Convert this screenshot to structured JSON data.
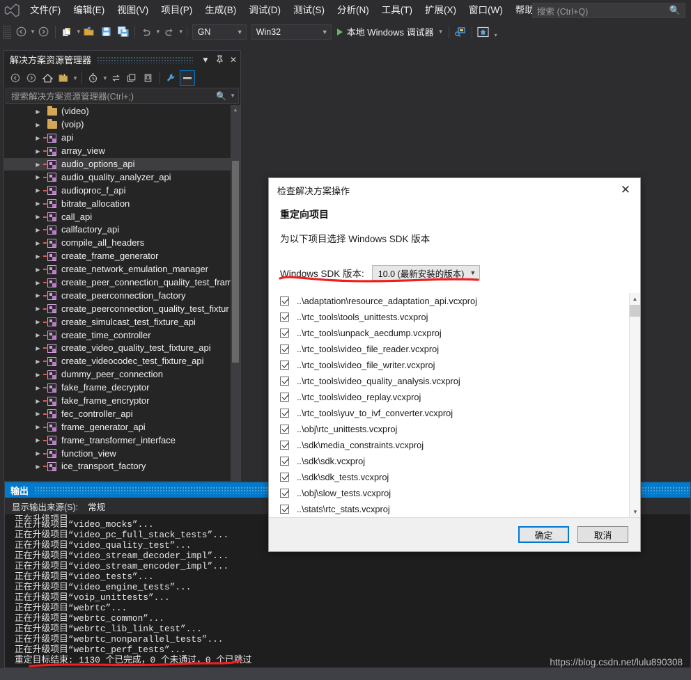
{
  "menubar": {
    "logo": "vs-logo",
    "items": [
      "文件(F)",
      "编辑(E)",
      "视图(V)",
      "项目(P)",
      "生成(B)",
      "调试(D)",
      "测试(S)",
      "分析(N)",
      "工具(T)",
      "扩展(X)",
      "窗口(W)",
      "帮助(H)"
    ],
    "search": {
      "placeholder": "搜索 (Ctrl+Q)",
      "icon": "search-icon"
    }
  },
  "toolbar": {
    "nav_back_icon": "arrow-back-icon",
    "nav_forward_icon": "arrow-forward-icon",
    "new_item_icon": "new-item-icon",
    "open_file_icon": "open-folder-icon",
    "save_icon": "save-icon",
    "save_all_icon": "save-all-icon",
    "undo_icon": "undo-icon",
    "redo_icon": "redo-icon",
    "config_combo": {
      "value": "GN",
      "caret": "chevron-down-icon"
    },
    "platform_combo": {
      "value": "Win32",
      "caret": "chevron-down-icon"
    },
    "run_label": "本地 Windows 调试器",
    "run_icon": "play-icon",
    "run_caret": "chevron-down-icon",
    "attach_icon": "attach-process-icon",
    "home_icon": "home-icon",
    "overflow_icon": "toolbar-overflow-icon"
  },
  "solution_explorer": {
    "title": "解决方案资源管理器",
    "title_dropdown_icon": "chevron-down-icon",
    "pin_icon": "pin-icon",
    "close_icon": "close-icon",
    "toolbar_icons": [
      "back-icon",
      "forward-icon",
      "home-icon",
      "show-all-files-icon",
      "pending-changes-icon",
      "sync-icon",
      "collapse-all-icon",
      "properties-icon",
      "wrench-icon",
      "preview-icon"
    ],
    "search": {
      "placeholder": "搜索解决方案资源管理器(Ctrl+;)",
      "icon": "search-icon",
      "caret": "chevron-down-icon"
    },
    "selected_index": 4,
    "items": [
      {
        "label": "(video)",
        "type": "folder"
      },
      {
        "label": "(voip)",
        "type": "folder"
      },
      {
        "label": "api",
        "type": "project"
      },
      {
        "label": "array_view",
        "type": "project"
      },
      {
        "label": "audio_options_api",
        "type": "project"
      },
      {
        "label": "audio_quality_analyzer_api",
        "type": "project"
      },
      {
        "label": "audioproc_f_api",
        "type": "project"
      },
      {
        "label": "bitrate_allocation",
        "type": "project"
      },
      {
        "label": "call_api",
        "type": "project"
      },
      {
        "label": "callfactory_api",
        "type": "project"
      },
      {
        "label": "compile_all_headers",
        "type": "project"
      },
      {
        "label": "create_frame_generator",
        "type": "project"
      },
      {
        "label": "create_network_emulation_manager",
        "type": "project"
      },
      {
        "label": "create_peer_connection_quality_test_fram",
        "type": "project"
      },
      {
        "label": "create_peerconnection_factory",
        "type": "project"
      },
      {
        "label": "create_peerconnection_quality_test_fixtur",
        "type": "project"
      },
      {
        "label": "create_simulcast_test_fixture_api",
        "type": "project"
      },
      {
        "label": "create_time_controller",
        "type": "project"
      },
      {
        "label": "create_video_quality_test_fixture_api",
        "type": "project"
      },
      {
        "label": "create_videocodec_test_fixture_api",
        "type": "project"
      },
      {
        "label": "dummy_peer_connection",
        "type": "project"
      },
      {
        "label": "fake_frame_decryptor",
        "type": "project"
      },
      {
        "label": "fake_frame_encryptor",
        "type": "project"
      },
      {
        "label": "fec_controller_api",
        "type": "project"
      },
      {
        "label": "frame_generator_api",
        "type": "project"
      },
      {
        "label": "frame_transformer_interface",
        "type": "project"
      },
      {
        "label": "function_view",
        "type": "project"
      },
      {
        "label": "ice_transport_factory",
        "type": "project"
      }
    ]
  },
  "output_panel": {
    "tab_label": "输出",
    "source_label": "显示输出来源(S):",
    "source_value": "常规",
    "lines": [
      "正在升级项目“video_mocks”...",
      "正在升级项目“video_pc_full_stack_tests”...",
      "正在升级项目“video_quality_test”...",
      "正在升级项目“video_stream_decoder_impl”...",
      "正在升级项目“video_stream_encoder_impl”...",
      "正在升级项目“video_tests”...",
      "正在升级项目“video_engine_tests”...",
      "正在升级项目“voip_unittests”...",
      "正在升级项目“webrtc”...",
      "正在升级项目“webrtc_common”...",
      "正在升级项目“webrtc_lib_link_test”...",
      "正在升级项目“webrtc_nonparallel_tests”...",
      "正在升级项目“webrtc_perf_tests”...",
      "重定目标结束: 1130 个已完成，0 个未通过，0 个已跳过"
    ]
  },
  "dialog": {
    "title": "检查解决方案操作",
    "close_icon": "close-icon",
    "heading": "重定向项目",
    "subtitle": "为以下项目选择 Windows SDK 版本",
    "sdk_label": "Windows SDK 版本:",
    "sdk_value": "10.0 (最新安装的版本)",
    "sdk_caret": "chevron-down-icon",
    "projects": [
      {
        "path": "..\\adaptation\\resource_adaptation_api.vcxproj",
        "checked": true
      },
      {
        "path": "..\\rtc_tools\\tools_unittests.vcxproj",
        "checked": true
      },
      {
        "path": "..\\rtc_tools\\unpack_aecdump.vcxproj",
        "checked": true
      },
      {
        "path": "..\\rtc_tools\\video_file_reader.vcxproj",
        "checked": true
      },
      {
        "path": "..\\rtc_tools\\video_file_writer.vcxproj",
        "checked": true
      },
      {
        "path": "..\\rtc_tools\\video_quality_analysis.vcxproj",
        "checked": true
      },
      {
        "path": "..\\rtc_tools\\video_replay.vcxproj",
        "checked": true
      },
      {
        "path": "..\\rtc_tools\\yuv_to_ivf_converter.vcxproj",
        "checked": true
      },
      {
        "path": "..\\obj\\rtc_unittests.vcxproj",
        "checked": true
      },
      {
        "path": "..\\sdk\\media_constraints.vcxproj",
        "checked": true
      },
      {
        "path": "..\\sdk\\sdk.vcxproj",
        "checked": true
      },
      {
        "path": "..\\sdk\\sdk_tests.vcxproj",
        "checked": true
      },
      {
        "path": "..\\obj\\slow_tests.vcxproj",
        "checked": true
      },
      {
        "path": "..\\stats\\rtc_stats.vcxproj",
        "checked": true
      }
    ],
    "ok_label": "确定",
    "cancel_label": "取消",
    "scroll_up_icon": "chevron-up-icon",
    "scroll_down_icon": "chevron-down-icon"
  },
  "watermark": "https://blog.csdn.net/lulu890308",
  "colors": {
    "accent": "#007acc",
    "annotation": "#f01e1e",
    "chrome_bg": "#2d2d30",
    "panel_bg": "#252526",
    "output_bg": "#1e1e1e",
    "dialog_bg": "#ffffff"
  }
}
